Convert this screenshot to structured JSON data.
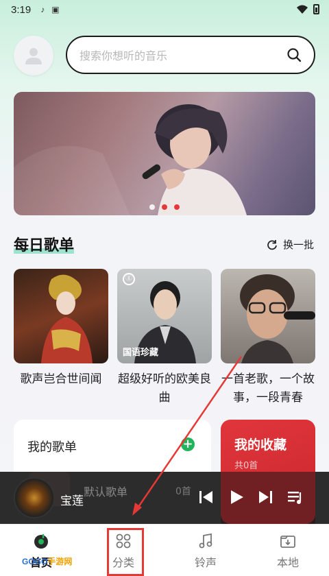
{
  "status": {
    "time": "3:19"
  },
  "search": {
    "placeholder": "搜索你想听的音乐"
  },
  "section": {
    "title": "每日歌单",
    "refresh_label": "换一批"
  },
  "playlists": [
    {
      "caption": "歌声岂合世间闻",
      "tag": ""
    },
    {
      "caption": "超级好听的欧美良曲",
      "tag": "国语珍藏"
    },
    {
      "caption": "一首老歌，一个故事，一段青春",
      "tag": ""
    }
  ],
  "my_list": {
    "title": "我的歌单",
    "default_name": "默认歌单",
    "default_count": "0首"
  },
  "favorites": {
    "title": "我的收藏",
    "count": "共0首"
  },
  "player": {
    "song": "宝莲"
  },
  "tabs": [
    {
      "label": "首页",
      "icon": "home-music-icon"
    },
    {
      "label": "分类",
      "icon": "category-grid-icon"
    },
    {
      "label": "铃声",
      "icon": "ringtone-note-icon"
    },
    {
      "label": "本地",
      "icon": "local-download-icon"
    }
  ],
  "watermark": {
    "text": "GOGO",
    "suffix": "手游网"
  },
  "colors": {
    "accent_green": "#22b45a",
    "favorite_red": "#d42e33",
    "highlight_red": "#e53935"
  }
}
